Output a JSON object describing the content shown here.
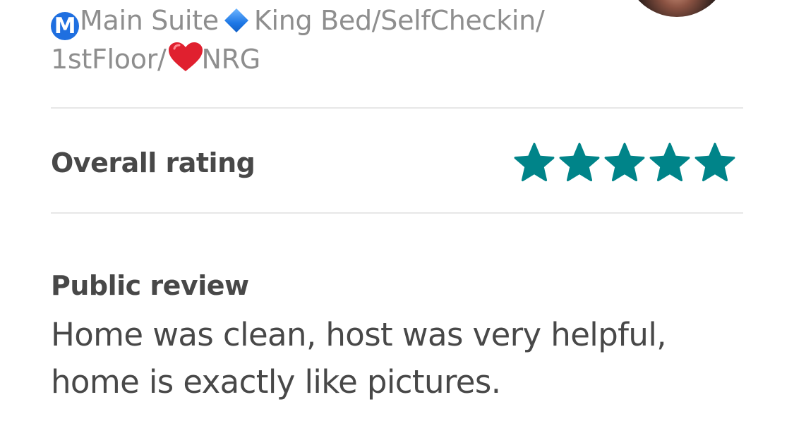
{
  "listing": {
    "badge_letter": "M",
    "name_part1": "Main Suite",
    "name_part2": "King Bed/SelfCheckin/",
    "name_part3": "1stFloor/",
    "name_part4": "NRG",
    "badge_icon": "m-circle-icon",
    "separator_icon": "blue-diamond-icon",
    "heart_icon": "red-heart-icon"
  },
  "overall_rating": {
    "label": "Overall rating",
    "stars": 5,
    "max_stars": 5,
    "star_color": "#008489"
  },
  "public_review": {
    "heading": "Public review",
    "text": "Home was clean, host was very helpful, home is exactly like pictures."
  },
  "colors": {
    "muted_text": "#8e8e8e",
    "body_text": "#484848",
    "divider": "#e7e7e7",
    "accent": "#008489"
  }
}
